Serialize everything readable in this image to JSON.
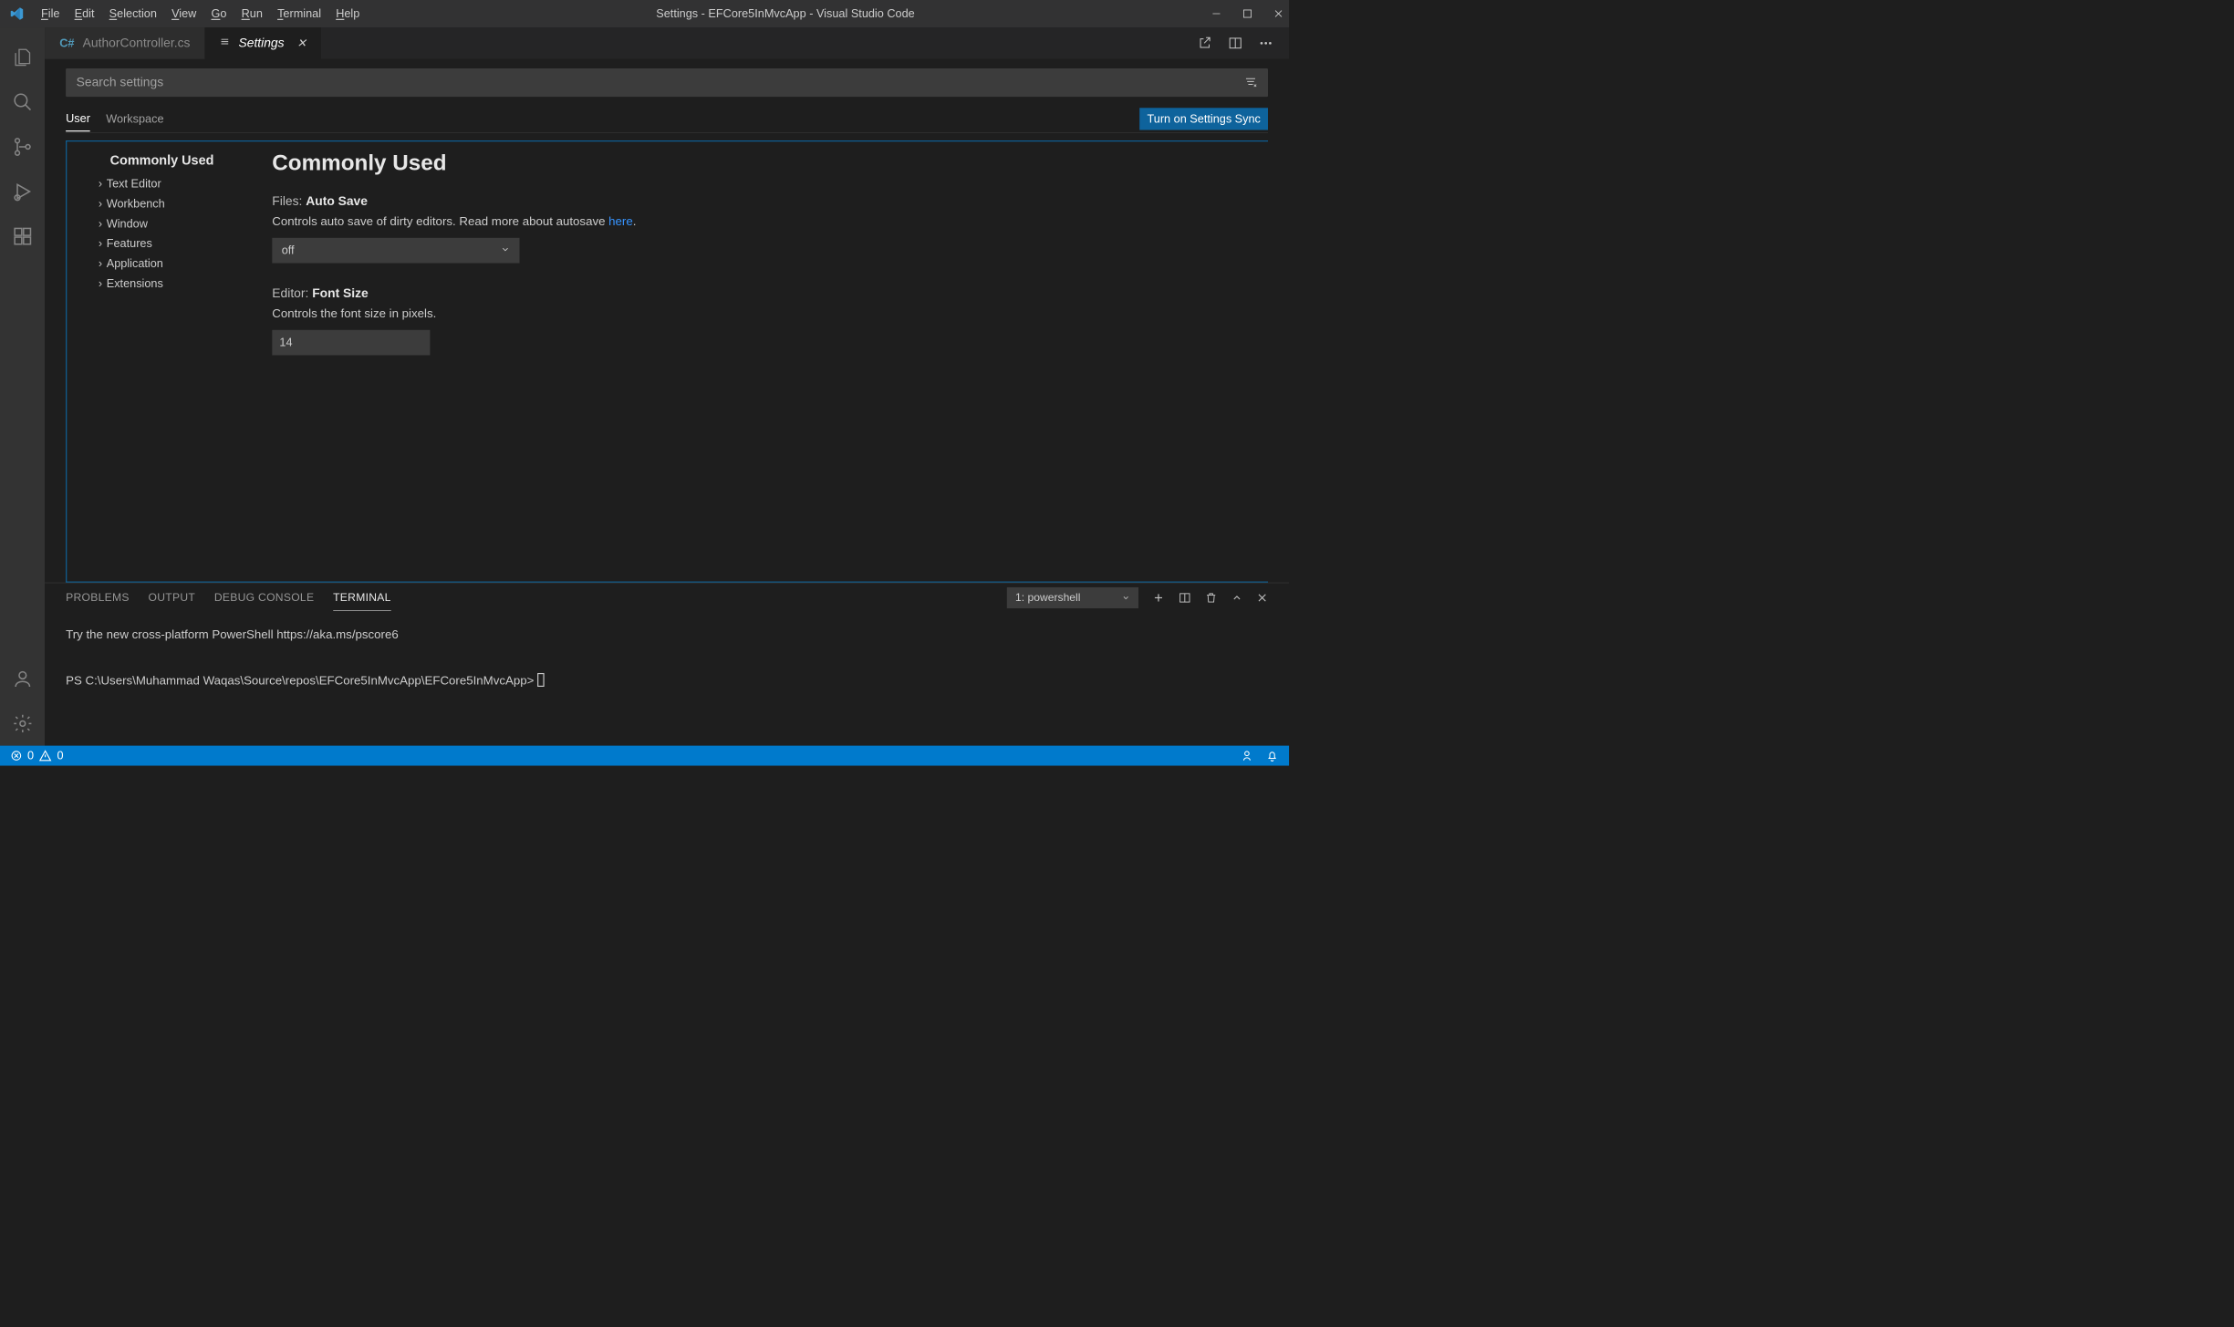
{
  "window_title": "Settings - EFCore5InMvcApp - Visual Studio Code",
  "menu": [
    "File",
    "Edit",
    "Selection",
    "View",
    "Go",
    "Run",
    "Terminal",
    "Help"
  ],
  "tabs": {
    "inactive": {
      "label": "AuthorController.cs"
    },
    "active": {
      "label": "Settings"
    }
  },
  "search": {
    "placeholder": "Search settings"
  },
  "scope": {
    "user": "User",
    "workspace": "Workspace"
  },
  "sync_button": "Turn on Settings Sync",
  "toc": {
    "heading": "Commonly Used",
    "items": [
      "Text Editor",
      "Workbench",
      "Window",
      "Features",
      "Application",
      "Extensions"
    ]
  },
  "content": {
    "heading": "Commonly Used",
    "auto_save": {
      "prefix": "Files:",
      "name": "Auto Save",
      "desc_1": "Controls auto save of dirty editors. Read more about autosave ",
      "link": "here",
      "desc_2": ".",
      "value": "off"
    },
    "font_size": {
      "prefix": "Editor:",
      "name": "Font Size",
      "desc": "Controls the font size in pixels.",
      "value": "14"
    }
  },
  "panel": {
    "tabs": [
      "PROBLEMS",
      "OUTPUT",
      "DEBUG CONSOLE",
      "TERMINAL"
    ],
    "active_tab": "TERMINAL",
    "terminal_selector": "1: powershell",
    "line1": "Try the new cross-platform PowerShell https://aka.ms/pscore6",
    "prompt": "PS C:\\Users\\Muhammad Waqas\\Source\\repos\\EFCore5InMvcApp\\EFCore5InMvcApp> "
  },
  "status": {
    "errors": "0",
    "warnings": "0"
  }
}
